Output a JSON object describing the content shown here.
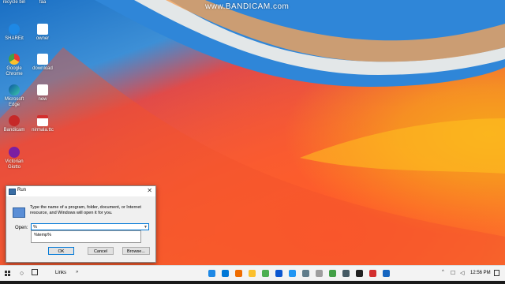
{
  "watermark": "www.BANDICAM.com",
  "desktop_icons": [
    {
      "label": "recycle bin"
    },
    {
      "label": "faa"
    },
    {
      "label": "SHAREit"
    },
    {
      "label": "owner"
    },
    {
      "label": "Google Chrome"
    },
    {
      "label": "download"
    },
    {
      "label": "Microsoft Edge"
    },
    {
      "label": "new"
    },
    {
      "label": "Bandicam"
    },
    {
      "label": "nirmala.ttc"
    },
    {
      "label": "Victorian Giotto"
    }
  ],
  "run_dialog": {
    "title": "Run",
    "close_glyph": "✕",
    "description": "Type the name of a program, folder, document, or Internet resource, and Windows will open it for you.",
    "open_label": "Open:",
    "open_value": "%",
    "suggestion": "%temp%",
    "ok_label": "OK",
    "cancel_label": "Cancel",
    "browse_label": "Browse..."
  },
  "taskbar": {
    "links_label": "Links",
    "links_chevron": "»",
    "tray_chevron": "^",
    "clock": "12:56 PM",
    "app_colors": [
      "#1e88e5",
      "#0078d7",
      "#ef6c00",
      "#fbc02d",
      "#4caf50",
      "#0b57d0",
      "#2196f3",
      "#607d8b",
      "#9e9e9e",
      "#43a047",
      "#455a64",
      "#212121",
      "#d32f2f",
      "#1565c0"
    ]
  }
}
